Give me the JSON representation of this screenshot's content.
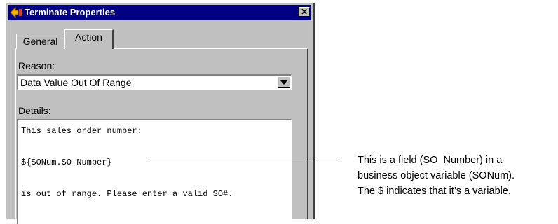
{
  "window": {
    "title": "Terminate Properties",
    "close_glyph": "✕",
    "icon": "terminate-arrow-icon"
  },
  "tabs": [
    {
      "label": "General",
      "active": false
    },
    {
      "label": "Action",
      "active": true
    }
  ],
  "reason": {
    "label": "Reason:",
    "value": "Data Value Out Of Range"
  },
  "details": {
    "label": "Details:",
    "lines": [
      "This sales order number:",
      "${SONum.SO_Number}",
      "is out of range. Please enter a valid SO#."
    ]
  },
  "callout": {
    "lines": [
      "This is a field (SO_Number) in a",
      "business object variable (SONum).",
      "The $ indicates that it’s a variable."
    ]
  }
}
